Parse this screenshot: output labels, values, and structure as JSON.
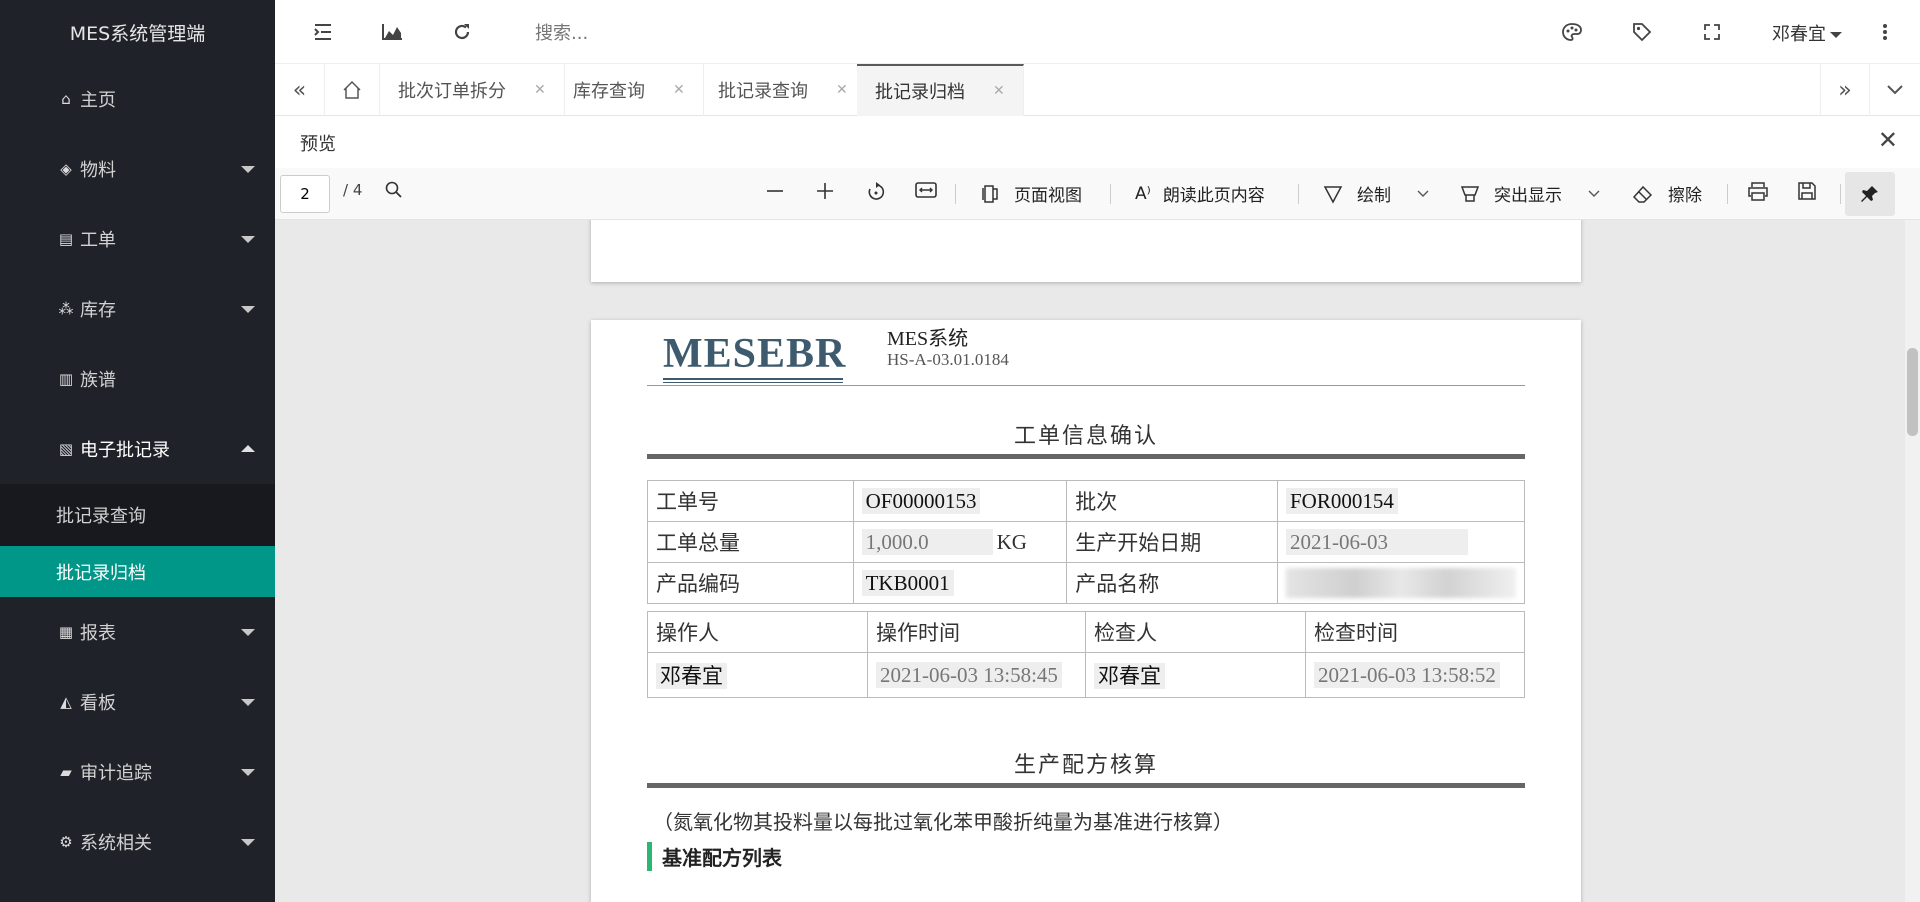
{
  "app": {
    "title": "MES系统管理端"
  },
  "sidebar": {
    "items": [
      {
        "label": "主页",
        "icon": "home-icon"
      },
      {
        "label": "物料",
        "icon": "cube-icon"
      },
      {
        "label": "工单",
        "icon": "file-icon"
      },
      {
        "label": "库存",
        "icon": "cubes-icon"
      },
      {
        "label": "族谱",
        "icon": "file-tree-icon"
      },
      {
        "label": "电子批记录",
        "icon": "pdf-file-icon"
      },
      {
        "label": "报表",
        "icon": "excel-file-icon"
      },
      {
        "label": "看板",
        "icon": "area-chart-icon"
      },
      {
        "label": "审计追踪",
        "icon": "book-icon"
      },
      {
        "label": "系统相关",
        "icon": "gears-icon"
      }
    ],
    "submenu": [
      "批记录查询",
      "批记录归档"
    ]
  },
  "header": {
    "search_placeholder": "搜索...",
    "user_name": "邓春宜"
  },
  "tabs": [
    "批次订单拆分",
    "库存查询",
    "批记录查询",
    "批记录归档"
  ],
  "preview": {
    "title": "预览"
  },
  "pdf_toolbar": {
    "page_current": "2",
    "page_total": "/ 4",
    "page_view": "页面视图",
    "read_aloud": "朗读此页内容",
    "draw": "绘制",
    "highlight": "突出显示",
    "erase": "擦除"
  },
  "document": {
    "logo": "MESEBR",
    "system": "MES系统",
    "code": "HS-A-03.01.0184",
    "section1": "工单信息确认",
    "info": {
      "order_no_label": "工单号",
      "order_no": "OF00000153",
      "batch_label": "批次",
      "batch": "FOR000154",
      "qty_label": "工单总量",
      "qty": "1,000.0",
      "unit": "KG",
      "start_label": "生产开始日期",
      "start": "2021-06-03",
      "product_code_label": "产品编码",
      "product_code": "TKB0001",
      "product_name_label": "产品名称"
    },
    "ops": {
      "operator_label": "操作人",
      "op_time_label": "操作时间",
      "checker_label": "检查人",
      "check_time_label": "检查时间",
      "operator": "邓春宜",
      "op_time": "2021-06-03 13:58:45",
      "checker": "邓春宜",
      "check_time": "2021-06-03 13:58:52"
    },
    "section2": "生产配方核算",
    "note": "（氮氧化物其投料量以每批过氧化苯甲酸折纯量为基准进行核算）",
    "sub_heading": "基准配方列表"
  }
}
